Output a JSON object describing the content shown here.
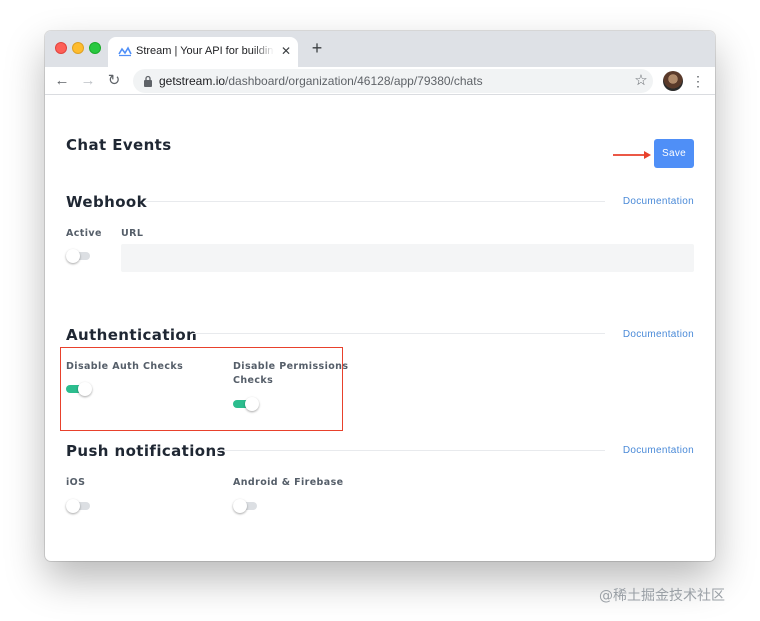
{
  "browser": {
    "tab_title": "Stream | Your API for building activity feeds",
    "tab_close": "✕",
    "new_tab": "+",
    "url_host": "getstream.io",
    "url_path": "/dashboard/organization/46128/app/79380/chats"
  },
  "page": {
    "title": "Chat Events",
    "save_label": "Save"
  },
  "webhook": {
    "title": "Webhook",
    "doc_link": "Documentation",
    "active_label": "Active",
    "active_on": false,
    "url_label": "URL",
    "url_value": ""
  },
  "authentication": {
    "title": "Authentication",
    "doc_link": "Documentation",
    "disable_auth_label": "Disable Auth Checks",
    "disable_auth_on": true,
    "disable_perm_label_line1": "Disable Permissions",
    "disable_perm_label_line2": "Checks",
    "disable_perm_on": true
  },
  "push": {
    "title": "Push notifications",
    "doc_link": "Documentation",
    "ios_label": "iOS",
    "ios_on": false,
    "android_label": "Android & Firebase",
    "android_on": false
  },
  "watermark": "@稀土掘金技术社区",
  "colors": {
    "accent": "#4f8ff7",
    "toggle_on": "#2cbd8e",
    "highlight": "#e8412c",
    "link": "#4a8ad8"
  },
  "icons": [
    "stream-favicon",
    "lock-icon",
    "star-icon",
    "back-icon",
    "forward-icon",
    "reload-icon",
    "menu-icon"
  ]
}
